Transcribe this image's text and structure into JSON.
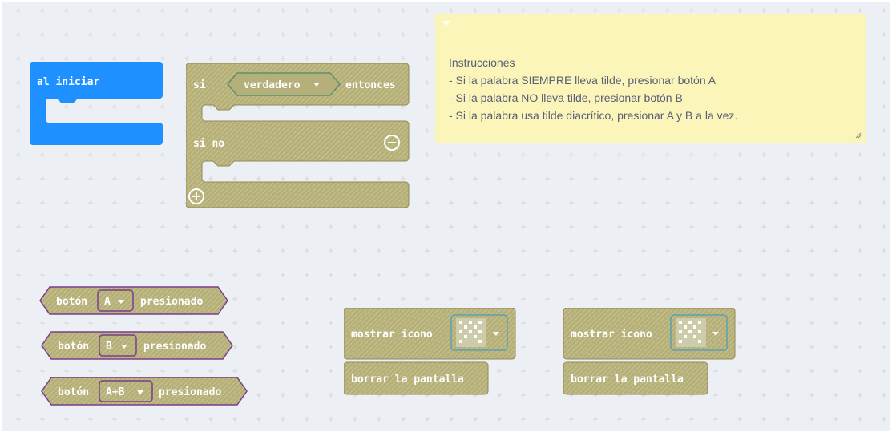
{
  "workspace": {
    "start_block": {
      "label": "al iniciar"
    },
    "if_block": {
      "if_label": "si",
      "condition": "verdadero",
      "then_label": "entonces",
      "else_label": "si no"
    },
    "note": {
      "title": "Instrucciones",
      "lines": [
        "- Si la palabra SIEMPRE lleva tilde, presionar botón A",
        "- Si la palabra NO lleva tilde, presionar botón B",
        "- Si la palabra usa tilde diacrítico, presionar A y B a la vez."
      ]
    },
    "button_blocks": [
      {
        "prefix": "botón",
        "button": "A",
        "suffix": "presionado"
      },
      {
        "prefix": "botón",
        "button": "B",
        "suffix": "presionado"
      },
      {
        "prefix": "botón",
        "button": "A+B",
        "suffix": "presionado"
      }
    ],
    "show_icon_blocks": [
      {
        "label": "mostrar ícono",
        "clear_label": "borrar la pantalla"
      },
      {
        "label": "mostrar ícono",
        "clear_label": "borrar la pantalla"
      }
    ],
    "colors": {
      "basic_blue": "#1e90ff",
      "logic_olive": "#b5b07a",
      "input_purple": "#7a3e8a",
      "note_yellow": "#fbf5ba",
      "workspace_bg": "#eceff3"
    },
    "icons": [
      "dropdown-arrow-icon",
      "remove-else-icon",
      "add-else-icon",
      "led-icon-preview"
    ]
  }
}
